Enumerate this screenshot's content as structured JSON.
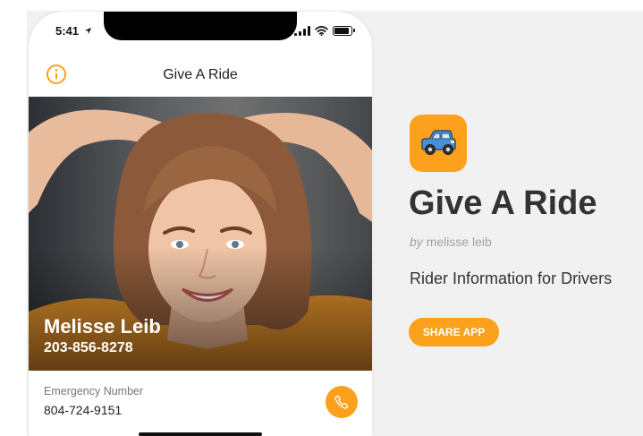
{
  "status_bar": {
    "time": "5:41"
  },
  "nav": {
    "title": "Give A Ride"
  },
  "rider": {
    "name": "Melisse Leib",
    "phone": "203-856-8278"
  },
  "emergency": {
    "label": "Emergency Number",
    "number": "804-724-9151"
  },
  "app": {
    "title": "Give A Ride",
    "by_prefix": "by",
    "author": "melisse leib",
    "description": "Rider Information for Drivers",
    "share_label": "SHARE APP"
  },
  "icons": {
    "info": "info-icon",
    "phone": "phone-icon",
    "car": "car-icon",
    "location": "location-arrow-icon",
    "signal": "signal-icon",
    "wifi": "wifi-icon",
    "battery": "battery-icon"
  },
  "colors": {
    "accent": "#fba11b",
    "car": "#4a90d9",
    "title": "#333333"
  }
}
